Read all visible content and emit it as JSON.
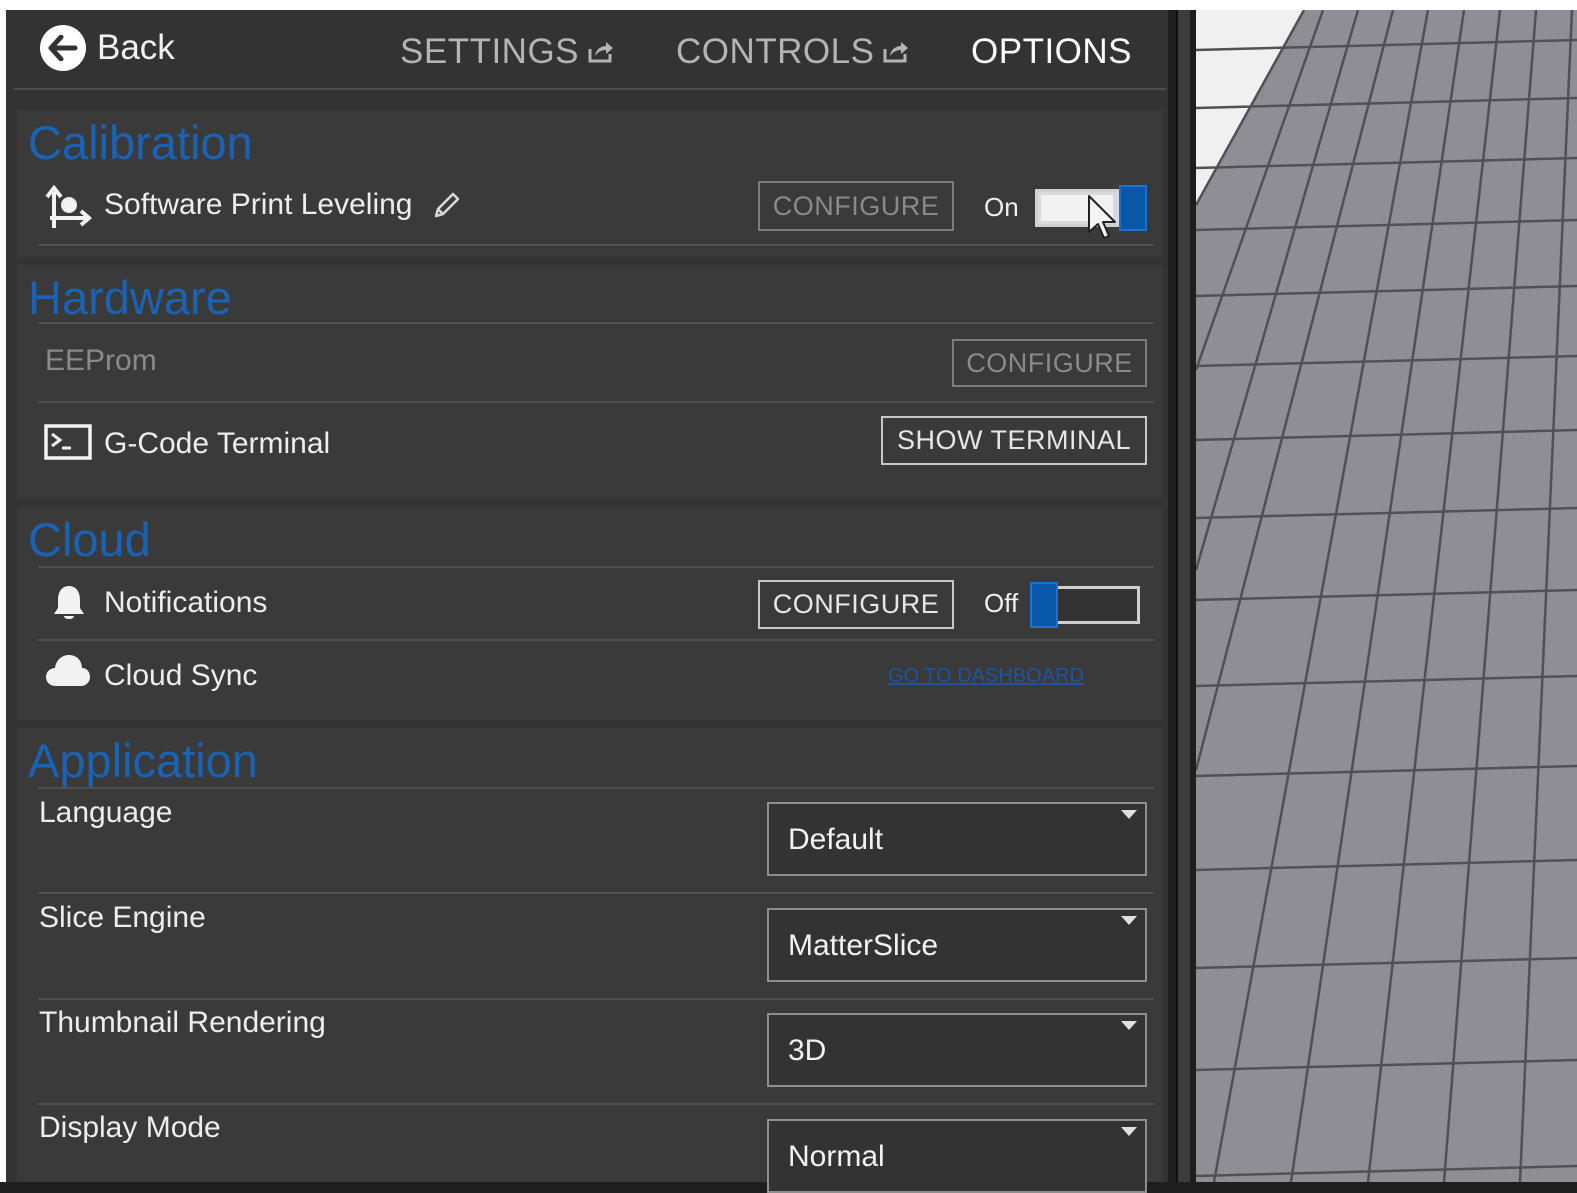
{
  "header": {
    "back_label": "Back",
    "tabs": [
      {
        "label": "SETTINGS",
        "active": false
      },
      {
        "label": "CONTROLS",
        "active": false
      },
      {
        "label": "OPTIONS",
        "active": true
      }
    ]
  },
  "calibration": {
    "title": "Calibration",
    "software_print_leveling": {
      "label": "Software Print Leveling",
      "configure_label": "CONFIGURE",
      "toggle_text": "On",
      "enabled": true
    }
  },
  "hardware": {
    "title": "Hardware",
    "eeprom": {
      "label": "EEProm",
      "configure_label": "CONFIGURE"
    },
    "gcode_terminal": {
      "label": "G-Code Terminal",
      "button_label": "SHOW TERMINAL"
    }
  },
  "cloud": {
    "title": "Cloud",
    "notifications": {
      "label": "Notifications",
      "configure_label": "CONFIGURE",
      "toggle_text": "Off",
      "enabled": false
    },
    "cloud_sync": {
      "label": "Cloud Sync",
      "link_text": "GO TO DASHBOARD"
    }
  },
  "application": {
    "title": "Application",
    "settings": [
      {
        "label": "Language",
        "value": "Default"
      },
      {
        "label": "Slice Engine",
        "value": "MatterSlice"
      },
      {
        "label": "Thumbnail Rendering",
        "value": "3D"
      },
      {
        "label": "Display Mode",
        "value": "Normal"
      }
    ]
  },
  "colors": {
    "accent": "#1a63b4",
    "toggle_knob": "#0a56a8",
    "panel_bg": "#333333",
    "section_bg": "#3a3a3a"
  },
  "icons": [
    "back-arrow-icon",
    "popout-icon",
    "leveling-icon",
    "edit-pencil-icon",
    "terminal-icon",
    "bell-icon",
    "cloud-icon",
    "dropdown-caret-icon",
    "mouse-cursor-icon"
  ]
}
